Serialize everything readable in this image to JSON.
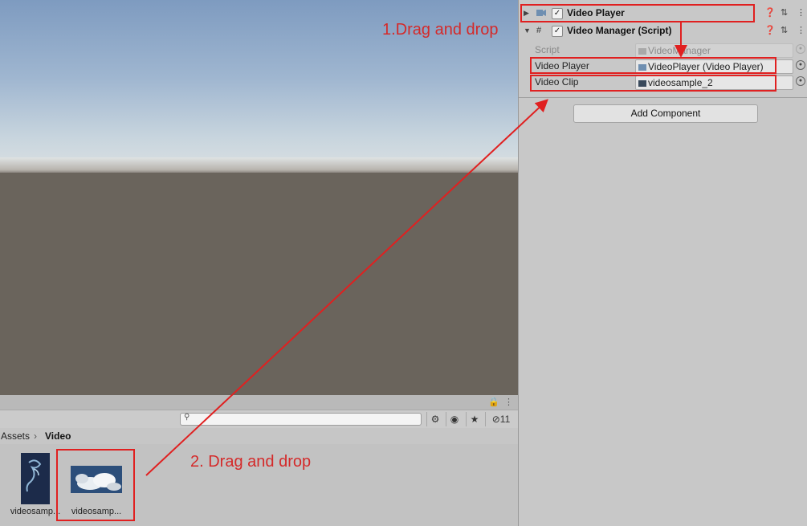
{
  "inspector": {
    "components": [
      {
        "title": "Video Player",
        "enabled": true
      },
      {
        "title": "Video Manager (Script)",
        "enabled": true
      }
    ],
    "properties": [
      {
        "label": "Script",
        "value": "VideoManager",
        "disabled": true
      },
      {
        "label": "Video Player",
        "value": "VideoPlayer (Video Player)"
      },
      {
        "label": "Video Clip",
        "value": "videosample_2"
      }
    ],
    "add_component_label": "Add Component"
  },
  "project": {
    "breadcrumb": [
      "Assets",
      "Video"
    ],
    "visibility_count": "11",
    "assets": [
      {
        "label": "videosamp..."
      },
      {
        "label": "videosamp..."
      }
    ]
  },
  "annotations": {
    "step1": "1.Drag and drop",
    "step2": "2. Drag and drop",
    "color": "#e02020"
  },
  "icons": {
    "foldout": "triangle-icon",
    "help": "help-icon",
    "presets": "sliders-icon",
    "menu": "kebab-menu-icon",
    "object_picker": "target-icon",
    "search": "magnifier-icon",
    "lock": "lock-icon"
  }
}
